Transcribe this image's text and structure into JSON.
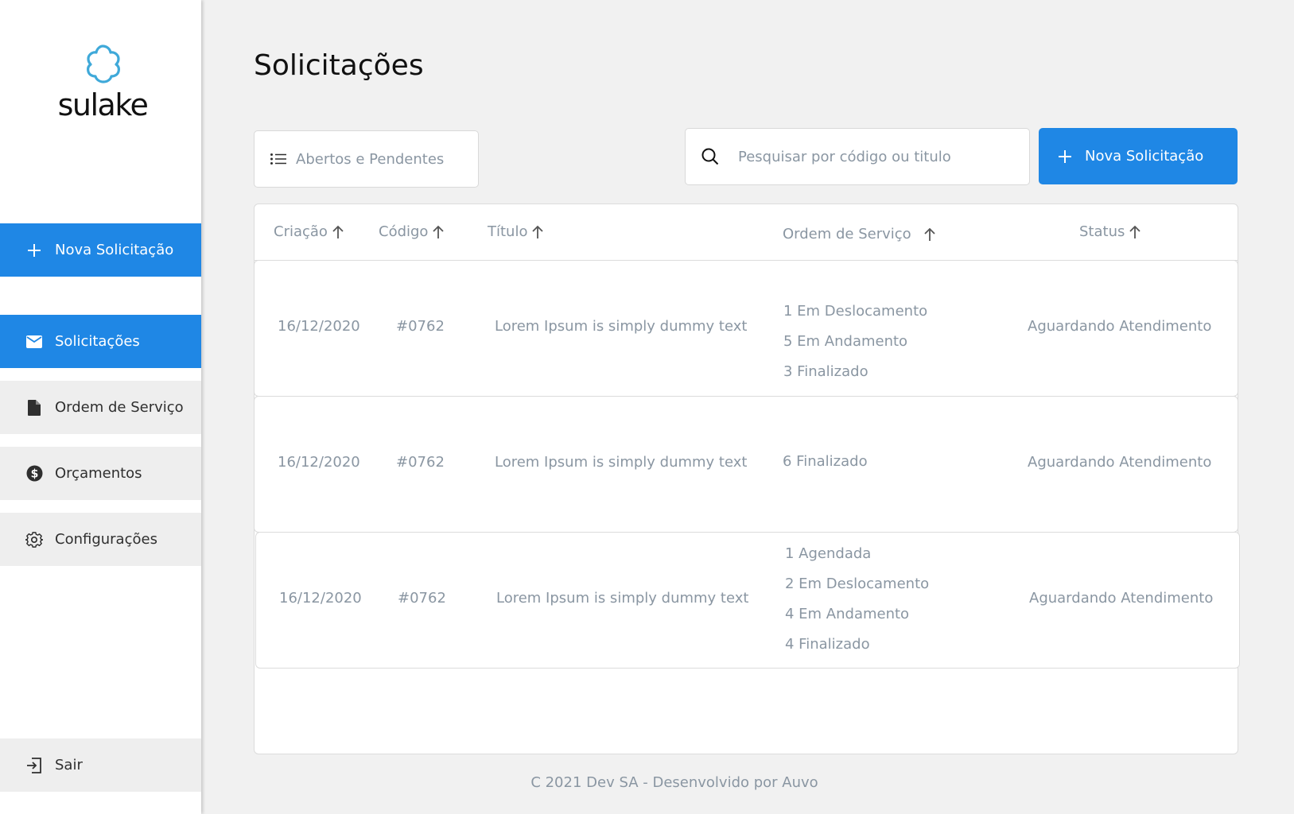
{
  "brand": {
    "name": "sulake",
    "logo_color": "#3fa9d9",
    "accent": "#1f87e5"
  },
  "sidebar": {
    "new_request": "Nova Solicitação",
    "items": [
      {
        "label": "Solicitações",
        "icon": "mail-icon",
        "active": true
      },
      {
        "label": "Ordem de Serviço",
        "icon": "document-icon",
        "active": false
      },
      {
        "label": "Orçamentos",
        "icon": "dollar-circle-icon",
        "active": false
      },
      {
        "label": "Configurações",
        "icon": "gear-icon",
        "active": false
      }
    ],
    "logout": "Sair"
  },
  "page": {
    "title": "Solicitações"
  },
  "toolbar": {
    "filter_label": "Abertos e Pendentes",
    "search_placeholder": "Pesquisar por código ou titulo",
    "new_button": "Nova Solicitação"
  },
  "table": {
    "columns": [
      "Criação",
      "Código",
      "Título",
      "Ordem de Serviço",
      "Status"
    ],
    "rows": [
      {
        "date": "16/12/2020",
        "code": "#0762",
        "title": "Lorem Ipsum is simply dummy text",
        "orders": [
          "1  Em Deslocamento",
          "5 Em Andamento",
          "3  Finalizado"
        ],
        "status": "Aguardando Atendimento"
      },
      {
        "date": "16/12/2020",
        "code": "#0762",
        "title": "Lorem Ipsum is simply dummy text",
        "orders": [
          "6 Finalizado"
        ],
        "status": "Aguardando Atendimento"
      },
      {
        "date": "16/12/2020",
        "code": "#0762",
        "title": "Lorem Ipsum is simply dummy text",
        "orders": [
          "1  Agendada",
          "2  Em Deslocamento",
          "4 Em Andamento",
          "4 Finalizado"
        ],
        "status": "Aguardando Atendimento"
      }
    ]
  },
  "footer": "C 2021 Dev SA - Desenvolvido por Auvo"
}
